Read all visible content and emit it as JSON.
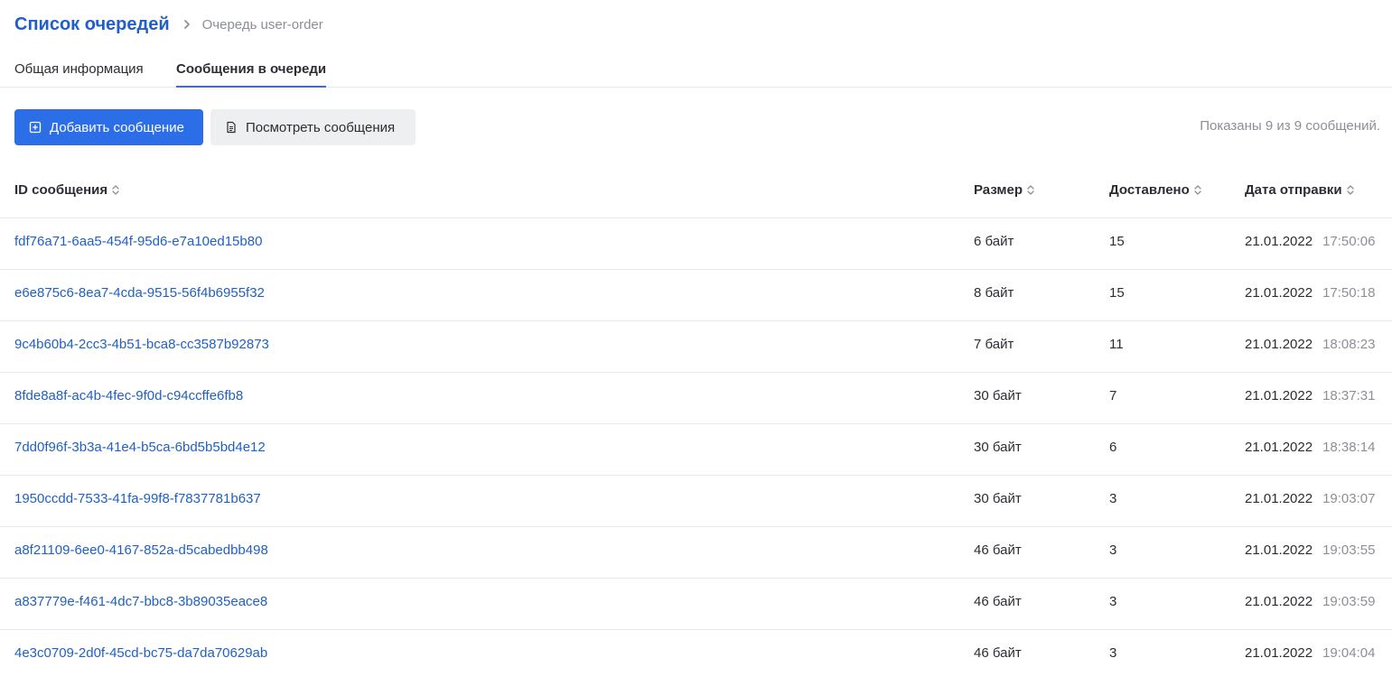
{
  "breadcrumb": {
    "title": "Список очередей",
    "current": "Очередь user-order"
  },
  "tabs": [
    {
      "label": "Общая информация",
      "active": false
    },
    {
      "label": "Сообщения в очереди",
      "active": true
    }
  ],
  "toolbar": {
    "add_label": "Добавить сообщение",
    "view_label": "Посмотреть сообщения",
    "count_text": "Показаны 9 из 9 сообщений."
  },
  "colors": {
    "accent": "#2c6de8",
    "link": "#2160c4",
    "muted": "#8c8f96"
  },
  "table": {
    "columns": [
      "ID сообщения",
      "Размер",
      "Доставлено",
      "Дата отправки"
    ],
    "rows": [
      {
        "id": "fdf76a71-6aa5-454f-95d6-e7a10ed15b80",
        "size": "6 байт",
        "delivered": "15",
        "date": "21.01.2022",
        "time": "17:50:06"
      },
      {
        "id": "e6e875c6-8ea7-4cda-9515-56f4b6955f32",
        "size": "8 байт",
        "delivered": "15",
        "date": "21.01.2022",
        "time": "17:50:18"
      },
      {
        "id": "9c4b60b4-2cc3-4b51-bca8-cc3587b92873",
        "size": "7 байт",
        "delivered": "11",
        "date": "21.01.2022",
        "time": "18:08:23"
      },
      {
        "id": "8fde8a8f-ac4b-4fec-9f0d-c94ccffe6fb8",
        "size": "30 байт",
        "delivered": "7",
        "date": "21.01.2022",
        "time": "18:37:31"
      },
      {
        "id": "7dd0f96f-3b3a-41e4-b5ca-6bd5b5bd4e12",
        "size": "30 байт",
        "delivered": "6",
        "date": "21.01.2022",
        "time": "18:38:14"
      },
      {
        "id": "1950ccdd-7533-41fa-99f8-f7837781b637",
        "size": "30 байт",
        "delivered": "3",
        "date": "21.01.2022",
        "time": "19:03:07"
      },
      {
        "id": "a8f21109-6ee0-4167-852a-d5cabedbb498",
        "size": "46 байт",
        "delivered": "3",
        "date": "21.01.2022",
        "time": "19:03:55"
      },
      {
        "id": "a837779e-f461-4dc7-bbc8-3b89035eace8",
        "size": "46 байт",
        "delivered": "3",
        "date": "21.01.2022",
        "time": "19:03:59"
      },
      {
        "id": "4e3c0709-2d0f-45cd-bc75-da7da70629ab",
        "size": "46 байт",
        "delivered": "3",
        "date": "21.01.2022",
        "time": "19:04:04"
      }
    ]
  }
}
